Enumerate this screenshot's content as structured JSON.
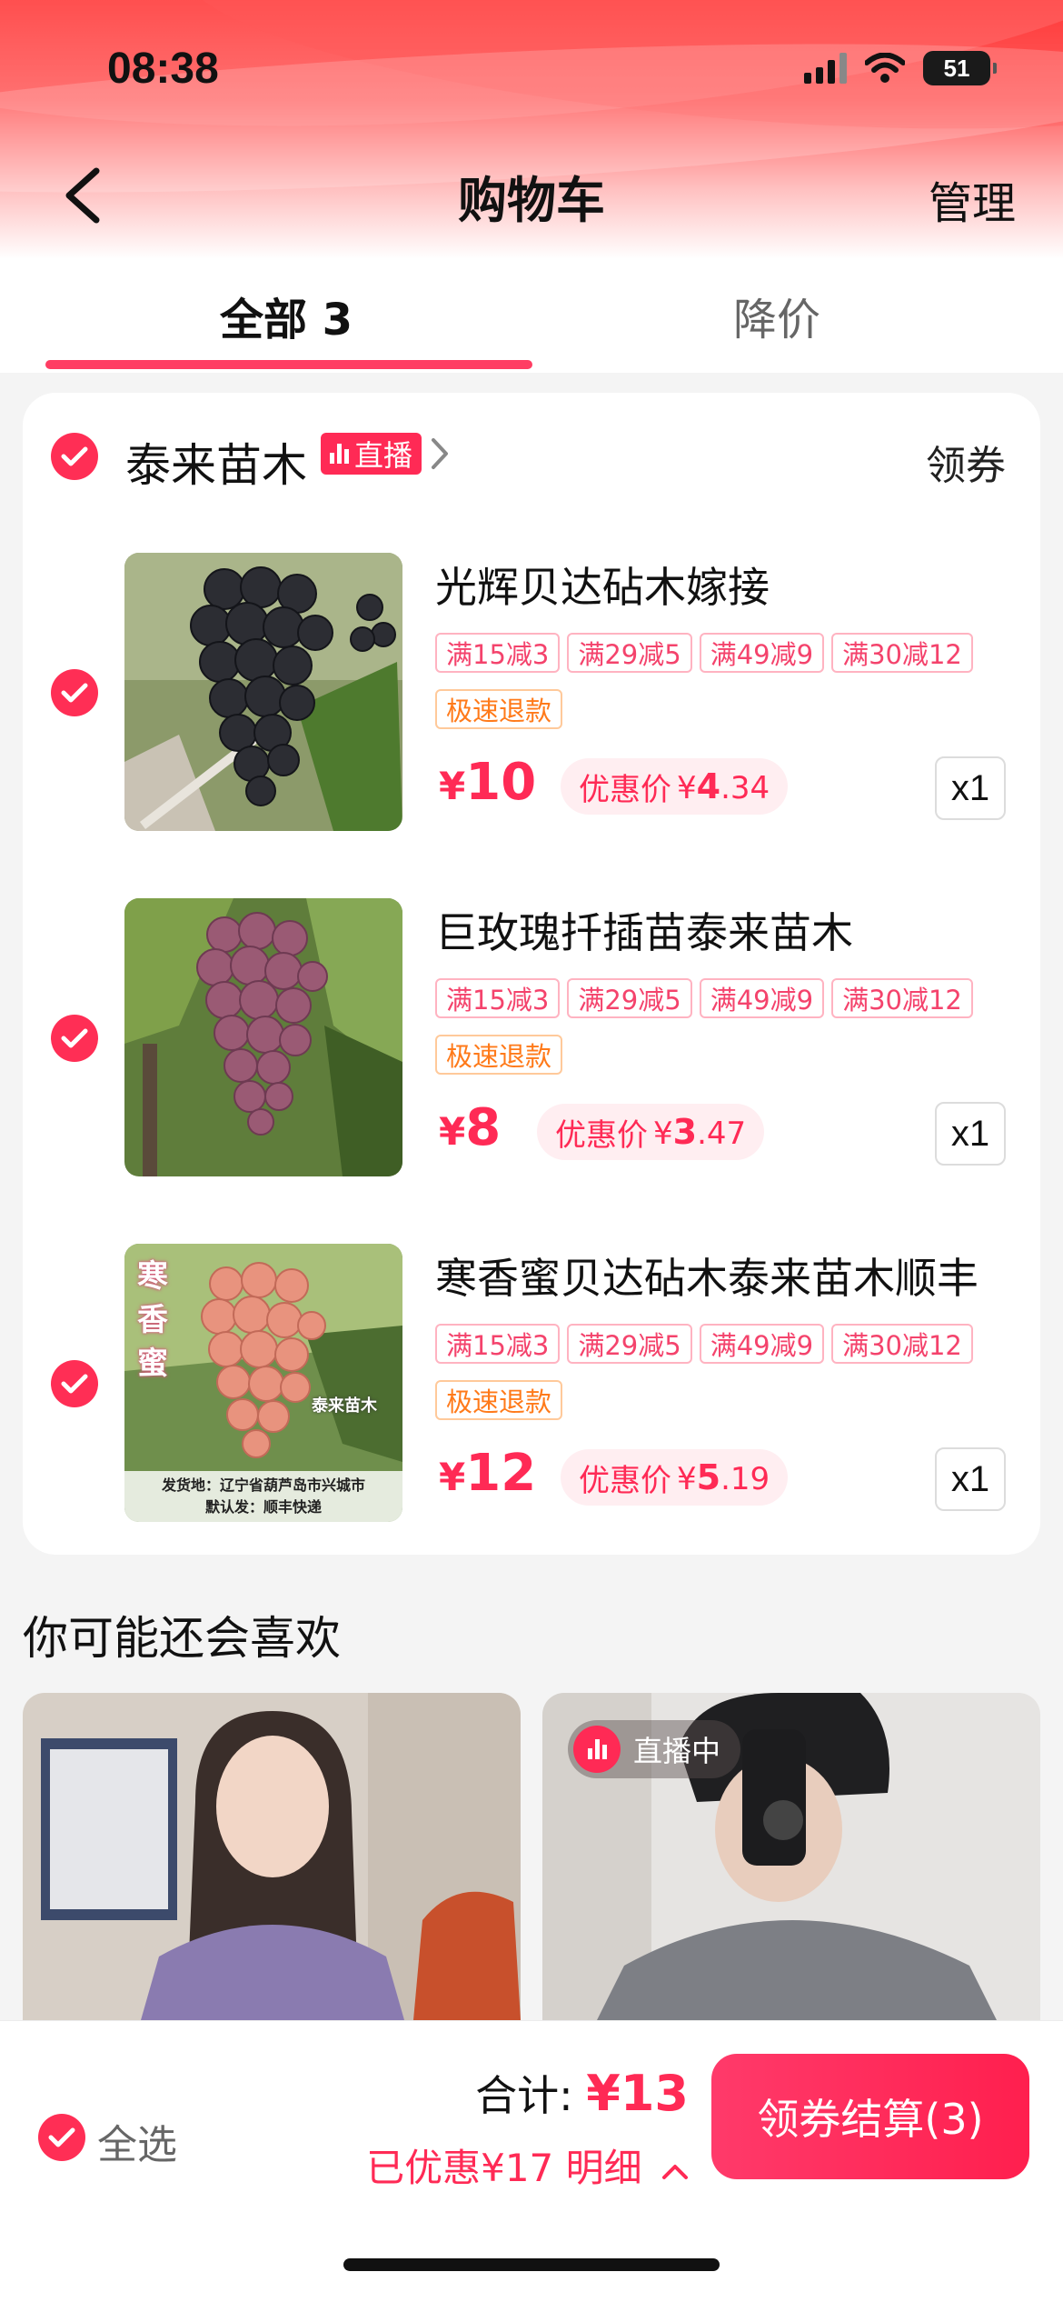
{
  "status_bar": {
    "time": "08:38",
    "battery": "51"
  },
  "nav": {
    "title": "购物车",
    "manage": "管理"
  },
  "tabs": [
    {
      "label": "全部 3"
    },
    {
      "label": "降价"
    }
  ],
  "store": {
    "name": "泰来苗木",
    "live_badge": "直播",
    "coupon_link": "领券",
    "items": [
      {
        "title": "光辉贝达砧木嫁接",
        "promos": [
          "满15减3",
          "满29减5",
          "满49减9",
          "满30减12"
        ],
        "service_tag": "极速退款",
        "currency": "¥",
        "price": "10",
        "discount_label": "优惠价",
        "discount_currency": "¥",
        "discount_int": "4",
        "discount_dec": ".34",
        "quantity": "x1",
        "image": {
          "grape_color": "#2c2d33"
        }
      },
      {
        "title": "巨玫瑰扦插苗泰来苗木",
        "promos": [
          "满15减3",
          "满29减5",
          "满49减9",
          "满30减12"
        ],
        "service_tag": "极速退款",
        "currency": "¥",
        "price": "8",
        "discount_label": "优惠价",
        "discount_currency": "¥",
        "discount_int": "3",
        "discount_dec": ".47",
        "quantity": "x1",
        "image": {
          "grape_color": "#9a5a74"
        }
      },
      {
        "title": "寒香蜜贝达砧木泰来苗木顺丰",
        "promos": [
          "满15减3",
          "满29减5",
          "满49减9",
          "满30减12"
        ],
        "service_tag": "极速退款",
        "currency": "¥",
        "price": "12",
        "discount_label": "优惠价",
        "discount_currency": "¥",
        "discount_int": "5",
        "discount_dec": ".19",
        "quantity": "x1",
        "image": {
          "grape_color": "#e8937e",
          "overlay_vertical": [
            "寒",
            "香",
            "蜜"
          ],
          "overlay_brand": "泰来苗木",
          "overlay_line1": "发货地：辽宁省葫芦岛市兴城市",
          "overlay_line2": "默认发：顺丰快递"
        }
      }
    ]
  },
  "recommend": {
    "title": "你可能还会喜欢",
    "live_label": "直播中"
  },
  "bottom": {
    "select_all": "全选",
    "total_label": "合计: ",
    "total_amount": "¥13",
    "saved_text": "已优惠¥17 明细",
    "checkout": "领券结算(3)"
  },
  "colors": {
    "accent": "#ff2a55",
    "promo": "#f4436c",
    "service": "#ff7a1a"
  }
}
